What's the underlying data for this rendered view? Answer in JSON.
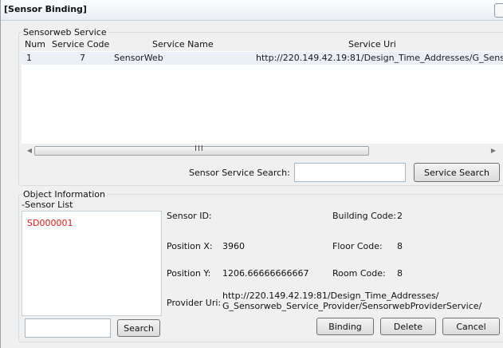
{
  "window": {
    "title": "[Sensor Binding]"
  },
  "sensorweb_service": {
    "group_label": "Sensorweb Service",
    "columns": [
      "Num",
      "Service Code",
      "Service Name",
      "Service Uri"
    ],
    "rows": [
      {
        "num": "1",
        "code": "7",
        "name": "SensorWeb",
        "uri": "http://220.149.42.19:81/Design_Time_Addresses/G_Sens"
      }
    ],
    "scroll_grip": "III",
    "search_label": "Sensor Service Search:",
    "search_value": "",
    "search_button": "Service Search"
  },
  "object_information": {
    "group_label": "Object Information",
    "sensor_list_label": "-Sensor List",
    "sensors": [
      "SD000001"
    ],
    "fields": {
      "sensor_id_label": "Sensor ID:",
      "sensor_id": "",
      "building_code_label": "Building Code:",
      "building_code": "2",
      "position_x_label": "Position X:",
      "position_x": "3960",
      "floor_code_label": "Floor Code:",
      "floor_code": "8",
      "position_y_label": "Position Y:",
      "position_y": "1206.66666666667",
      "room_code_label": "Room Code:",
      "room_code": "8",
      "provider_uri_label": "Provider Uri:",
      "provider_uri_line1": "http://220.149.42.19:81/Design_Time_Addresses/",
      "provider_uri_line2": "G_Sensorweb_Service_Provider/SensorwebProviderService/"
    },
    "search_value": "",
    "search_button": "Search",
    "binding_button": "Binding",
    "delete_button": "Delete",
    "cancel_button": "Cancel"
  },
  "colors": {
    "selected_sensor": "#e01818",
    "row_highlight": "#eaf0f6"
  }
}
